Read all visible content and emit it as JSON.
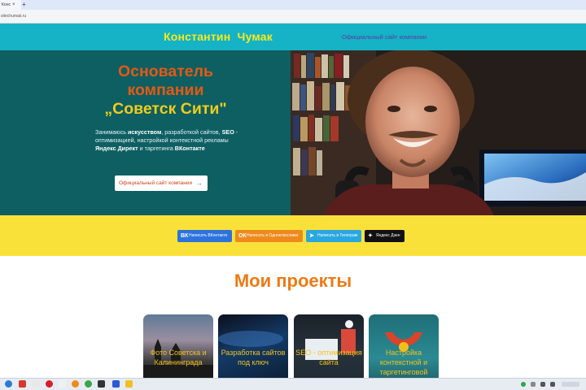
{
  "browser": {
    "tab_title": "Конс",
    "tab_close": "×",
    "new_tab": "+",
    "url": "sitechumak.ru"
  },
  "header": {
    "brand": "Константин  Чумак",
    "nav_link": "Официальный сайт компании"
  },
  "hero": {
    "title_line1": "Основатель",
    "title_line2": "компании",
    "title_line3": "„Советск Сити\"",
    "text_1": "Занимаюсь ",
    "text_bold_1": "искусством",
    "text_2": ", разработкой сайтов, ",
    "text_bold_2": "SEO",
    "text_3": " - оптимизацией, настройкой контекстной рекламы ",
    "text_bold_3": "Яндекс Директ",
    "text_4": " и таргетинга ",
    "text_bold_4": "ВКонтакте",
    "button_label": "Официальный сайт компании",
    "button_arrow": "→"
  },
  "social": {
    "buttons": [
      {
        "label": "Написать ВКонтакте",
        "icon": "vk-icon",
        "glyph": "ВК"
      },
      {
        "label": "Написать в Одноклассники",
        "icon": "ok-icon",
        "glyph": "ОК"
      },
      {
        "label": "Написать в Телеграм",
        "icon": "telegram-icon",
        "glyph": "➤"
      },
      {
        "label": "Яндекс Дзен",
        "icon": "dzen-icon",
        "glyph": "✦"
      }
    ]
  },
  "projects": {
    "title": "Мои проекты",
    "cards": [
      {
        "label": "Фото Советска и Калининграда"
      },
      {
        "label": "Разработка сайтов под ключ"
      },
      {
        "label": "SEO - оптимизация сайта"
      },
      {
        "label": "Настройка контекстной и таргетинговой рекламы"
      }
    ]
  },
  "colors": {
    "header": "#16b2c5",
    "brand": "#f4ea1c",
    "hero_bg": "#0d5f62",
    "title_orange": "#e35a14",
    "title_yellow": "#f0cc1a",
    "band": "#fae13a",
    "projects_title": "#ee7a15"
  }
}
